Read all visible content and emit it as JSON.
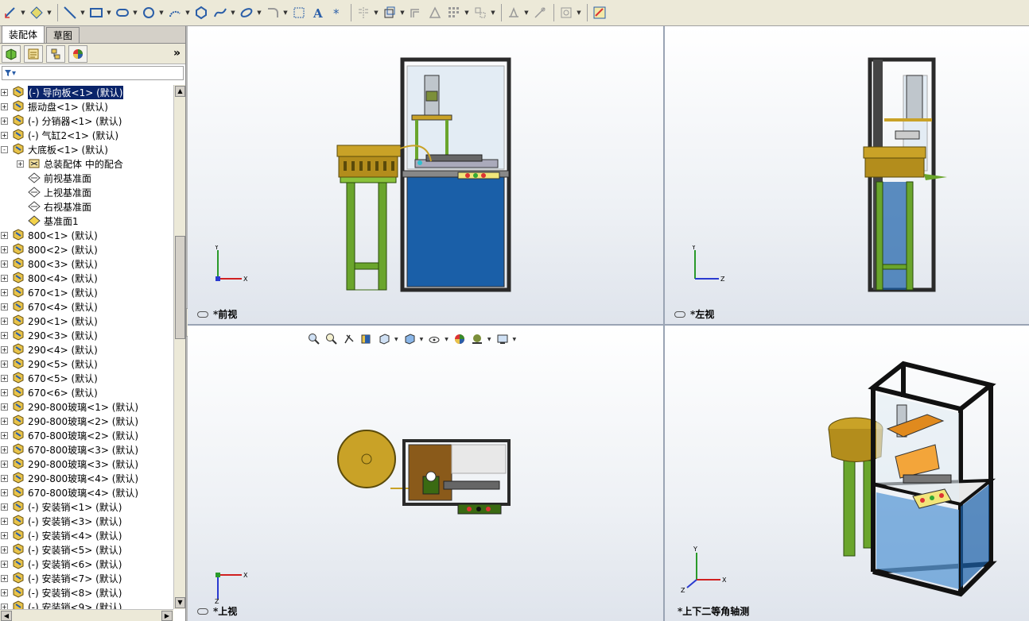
{
  "toolbar": {
    "icons": [
      "smart-dimension-icon",
      "sketch-icon",
      "line-icon",
      "rectangle-icon",
      "slot-icon",
      "circle-icon",
      "arc-icon",
      "polygon-icon",
      "spline-icon",
      "ellipse-icon",
      "fillet-icon",
      "chamfer-icon",
      "text-icon",
      "point-icon",
      "mirror-icon",
      "convert-entities-icon",
      "offset-entities-icon",
      "trim-icon",
      "linear-pattern-icon",
      "move-entities-icon",
      "display-relations-icon",
      "repair-sketch-icon",
      "quick-snaps-icon",
      "rapid-sketch-icon"
    ]
  },
  "panel": {
    "tabs": [
      {
        "label": "装配体",
        "active": true
      },
      {
        "label": "草图",
        "active": false
      }
    ],
    "icons": [
      "feature-manager-icon",
      "property-manager-icon",
      "configuration-manager-icon",
      "display-manager-icon"
    ],
    "expand_label": "»",
    "filter_label": "▾"
  },
  "tree": [
    {
      "label": "(-) 导向板<1> (默认)",
      "expand": "+",
      "indent": 0,
      "icon": "part",
      "selected": true
    },
    {
      "label": "振动盘<1> (默认)",
      "expand": "+",
      "indent": 0,
      "icon": "part"
    },
    {
      "label": "(-) 分销器<1> (默认)",
      "expand": "+",
      "indent": 0,
      "icon": "part"
    },
    {
      "label": "(-) 气缸2<1> (默认)",
      "expand": "+",
      "indent": 0,
      "icon": "part"
    },
    {
      "label": "大底板<1> (默认)",
      "expand": "-",
      "indent": 0,
      "icon": "part"
    },
    {
      "label": "总装配体 中的配合",
      "expand": "+",
      "indent": 1,
      "icon": "mates"
    },
    {
      "label": "前视基准面",
      "expand": "",
      "indent": 1,
      "icon": "plane"
    },
    {
      "label": "上视基准面",
      "expand": "",
      "indent": 1,
      "icon": "plane"
    },
    {
      "label": "右视基准面",
      "expand": "",
      "indent": 1,
      "icon": "plane"
    },
    {
      "label": "基准面1",
      "expand": "",
      "indent": 1,
      "icon": "plane-yellow"
    },
    {
      "label": "800<1> (默认)",
      "expand": "+",
      "indent": 0,
      "icon": "part"
    },
    {
      "label": "800<2> (默认)",
      "expand": "+",
      "indent": 0,
      "icon": "part"
    },
    {
      "label": "800<3> (默认)",
      "expand": "+",
      "indent": 0,
      "icon": "part"
    },
    {
      "label": "800<4> (默认)",
      "expand": "+",
      "indent": 0,
      "icon": "part"
    },
    {
      "label": "670<1> (默认)",
      "expand": "+",
      "indent": 0,
      "icon": "part"
    },
    {
      "label": "670<4> (默认)",
      "expand": "+",
      "indent": 0,
      "icon": "part"
    },
    {
      "label": "290<1> (默认)",
      "expand": "+",
      "indent": 0,
      "icon": "part"
    },
    {
      "label": "290<3> (默认)",
      "expand": "+",
      "indent": 0,
      "icon": "part"
    },
    {
      "label": "290<4> (默认)",
      "expand": "+",
      "indent": 0,
      "icon": "part"
    },
    {
      "label": "290<5> (默认)",
      "expand": "+",
      "indent": 0,
      "icon": "part"
    },
    {
      "label": "670<5> (默认)",
      "expand": "+",
      "indent": 0,
      "icon": "part"
    },
    {
      "label": "670<6> (默认)",
      "expand": "+",
      "indent": 0,
      "icon": "part"
    },
    {
      "label": "290-800玻璃<1> (默认)",
      "expand": "+",
      "indent": 0,
      "icon": "part"
    },
    {
      "label": "290-800玻璃<2> (默认)",
      "expand": "+",
      "indent": 0,
      "icon": "part"
    },
    {
      "label": "670-800玻璃<2> (默认)",
      "expand": "+",
      "indent": 0,
      "icon": "part"
    },
    {
      "label": "670-800玻璃<3> (默认)",
      "expand": "+",
      "indent": 0,
      "icon": "part"
    },
    {
      "label": "290-800玻璃<3> (默认)",
      "expand": "+",
      "indent": 0,
      "icon": "part"
    },
    {
      "label": "290-800玻璃<4> (默认)",
      "expand": "+",
      "indent": 0,
      "icon": "part"
    },
    {
      "label": "670-800玻璃<4> (默认)",
      "expand": "+",
      "indent": 0,
      "icon": "part"
    },
    {
      "label": "(-) 安装销<1> (默认)",
      "expand": "+",
      "indent": 0,
      "icon": "part"
    },
    {
      "label": "(-) 安装销<3> (默认)",
      "expand": "+",
      "indent": 0,
      "icon": "part"
    },
    {
      "label": "(-) 安装销<4> (默认)",
      "expand": "+",
      "indent": 0,
      "icon": "part"
    },
    {
      "label": "(-) 安装销<5> (默认)",
      "expand": "+",
      "indent": 0,
      "icon": "part"
    },
    {
      "label": "(-) 安装销<6> (默认)",
      "expand": "+",
      "indent": 0,
      "icon": "part"
    },
    {
      "label": "(-) 安装销<7> (默认)",
      "expand": "+",
      "indent": 0,
      "icon": "part"
    },
    {
      "label": "(-) 安装销<8> (默认)",
      "expand": "+",
      "indent": 0,
      "icon": "part"
    },
    {
      "label": "(-) 安装销<9> (默认)",
      "expand": "+",
      "indent": 0,
      "icon": "part"
    }
  ],
  "viewports": {
    "front": {
      "label": "*前视",
      "axes": [
        "Y",
        "X"
      ]
    },
    "left": {
      "label": "*左视",
      "axes": [
        "Y",
        "Z"
      ]
    },
    "top": {
      "label": "*上视",
      "axes": [
        "X",
        "Z"
      ]
    },
    "iso": {
      "label": "*上下二等角轴测",
      "axes": [
        "Y",
        "X",
        "Z"
      ]
    }
  },
  "heads_up_toolbar": {
    "icons": [
      "zoom-to-fit-icon",
      "zoom-to-area-icon",
      "previous-view-icon",
      "section-view-icon",
      "view-orientation-icon",
      "display-style-icon",
      "hide-show-items-icon",
      "edit-appearance-icon",
      "apply-scene-icon",
      "view-settings-icon"
    ]
  },
  "colors": {
    "frame": "#2a2a2a",
    "cabinet_blue": "#1a5fa8",
    "stand_green": "#6aa52c",
    "bowl_gold": "#c9a227",
    "plate_orange": "#e08a1e",
    "selection": "#0a246a"
  }
}
